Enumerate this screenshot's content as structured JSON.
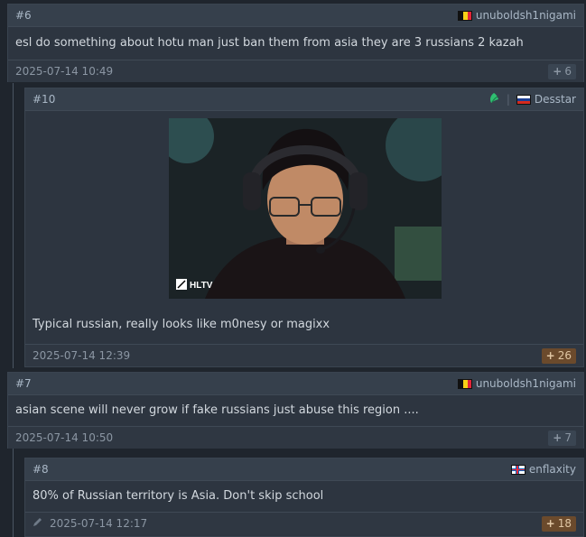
{
  "posts": [
    {
      "num": "#6",
      "user": "unuboldsh1nigami",
      "flag": "belgium",
      "text": "esl do something about hotu man just ban them from asia they are 3 russians 2 kazah",
      "time": "2025-07-14 10:49",
      "votes": "6"
    },
    {
      "num": "#10",
      "user": "Desstar",
      "flag": "russia",
      "team_icon": "leaf-team-icon",
      "image_watermark": "HLTV",
      "text": "Typical russian, really looks like m0nesy or magixx",
      "time": "2025-07-14 12:39",
      "votes": "26"
    },
    {
      "num": "#7",
      "user": "unuboldsh1nigami",
      "flag": "belgium",
      "text": "asian scene will never grow if fake russians just abuse this region ....",
      "time": "2025-07-14 10:50",
      "votes": "7"
    },
    {
      "num": "#8",
      "user": "enflaxity",
      "flag": "faroe-islands",
      "text": "80% of Russian territory is Asia. Don't skip school",
      "time": "2025-07-14 12:17",
      "votes": "18"
    }
  ],
  "colors": {
    "background": "#1f252d",
    "post_bg": "#2d3540",
    "vote_hot": "#6b4a2c",
    "vote_normal": "#3a4552"
  }
}
